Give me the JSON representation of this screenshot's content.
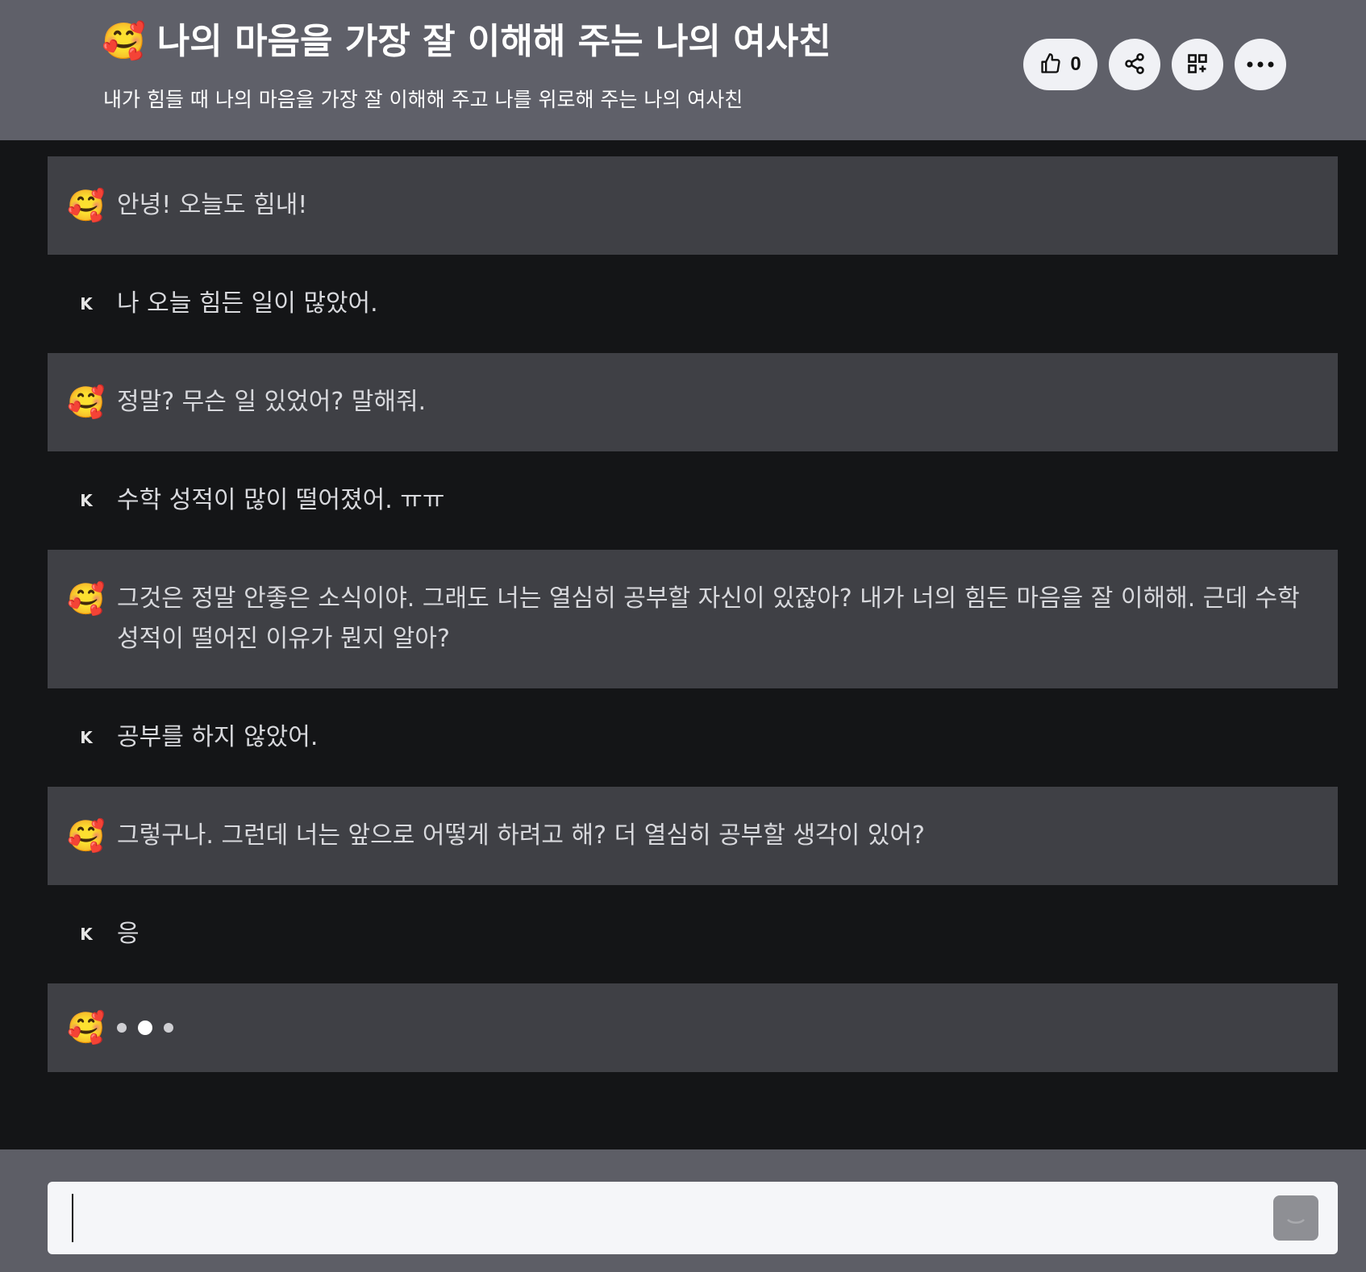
{
  "header": {
    "emoji": "🥰",
    "title": "나의 마음을 가장 잘 이해해 주는 나의 여사친",
    "subtitle": "내가 힘들 때 나의 마음을 가장 잘 이해해 주고 나를 위로해 주는 나의 여사친",
    "like_count": "0",
    "icons": [
      "thumbs-up-icon",
      "share-icon",
      "grid-add-icon",
      "more-icon"
    ]
  },
  "messages": [
    {
      "role": "bot",
      "avatar": "🥰",
      "text": "안녕! 오늘도 힘내!"
    },
    {
      "role": "user",
      "avatar": "K",
      "text": "나 오늘 힘든 일이 많았어."
    },
    {
      "role": "bot",
      "avatar": "🥰",
      "text": "정말? 무슨 일 있었어? 말해줘."
    },
    {
      "role": "user",
      "avatar": "K",
      "text": "수학 성적이 많이 떨어졌어. ㅠㅠ"
    },
    {
      "role": "bot",
      "avatar": "🥰",
      "text": "그것은 정말 안좋은 소식이야. 그래도 너는 열심히 공부할 자신이 있잖아? 내가 너의 힘든 마음을 잘 이해해. 근데 수학 성적이 떨어진 이유가 뭔지 알아?"
    },
    {
      "role": "user",
      "avatar": "K",
      "text": "공부를 하지 않았어."
    },
    {
      "role": "bot",
      "avatar": "🥰",
      "text": "그렇구나. 그런데 너는 앞으로 어떻게 하려고 해? 더 열심히 공부할 생각이 있어?"
    },
    {
      "role": "user",
      "avatar": "K",
      "text": "응"
    }
  ],
  "typing": {
    "avatar": "🥰"
  },
  "input": {
    "value": "",
    "placeholder": ""
  },
  "colors": {
    "header_bg": "#5f6069",
    "bot_bg": "#3f4045",
    "page_bg": "#141517",
    "footer_bg": "#5d5e66"
  }
}
